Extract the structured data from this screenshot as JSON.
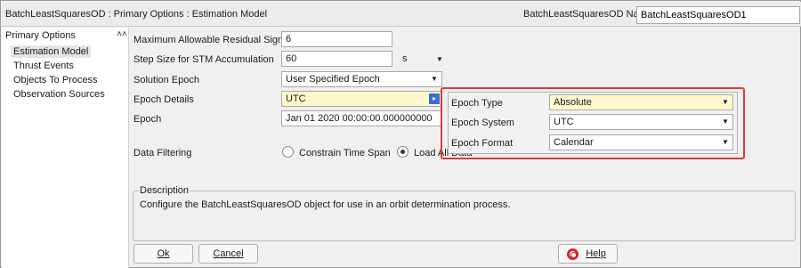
{
  "window": {
    "title": "BatchLeastSquaresOD : Primary Options : Estimation Model",
    "name_label": "BatchLeastSquaresOD Name",
    "name_value": "BatchLeastSquaresOD1"
  },
  "sidebar": {
    "header": "Primary Options",
    "collapse_icon": "double-chevron-up-icon",
    "items": [
      {
        "label": "Estimation Model",
        "selected": true
      },
      {
        "label": "Thrust Events",
        "selected": false
      },
      {
        "label": "Objects To Process",
        "selected": false
      },
      {
        "label": "Observation Sources",
        "selected": false
      }
    ]
  },
  "form": {
    "max_residual_sigma": {
      "label": "Maximum Allowable Residual Sigma",
      "value": "6"
    },
    "step_size": {
      "label": "Step Size for STM Accumulation",
      "value": "60",
      "unit": "s"
    },
    "solution_epoch": {
      "label": "Solution Epoch",
      "value": "User Specified Epoch"
    },
    "epoch_details": {
      "label": "Epoch Details",
      "value": "UTC"
    },
    "epoch": {
      "label": "Epoch",
      "value": "Jan 01 2020 00:00:00.000000000"
    },
    "data_filtering": {
      "label": "Data Filtering",
      "options": [
        {
          "label": "Constrain Time Span",
          "selected": false
        },
        {
          "label": "Load All Data",
          "selected": true
        }
      ]
    }
  },
  "epoch_popup": {
    "epoch_type": {
      "label": "Epoch Type",
      "value": "Absolute"
    },
    "epoch_system": {
      "label": "Epoch System",
      "value": "UTC"
    },
    "epoch_format": {
      "label": "Epoch Format",
      "value": "Calendar"
    },
    "highlight_color": "#e0383d"
  },
  "description": {
    "legend": "Description",
    "text": "Configure the BatchLeastSquaresOD object for use in an orbit determination process."
  },
  "buttons": {
    "ok": "Ok",
    "cancel": "Cancel",
    "help": "Help"
  }
}
